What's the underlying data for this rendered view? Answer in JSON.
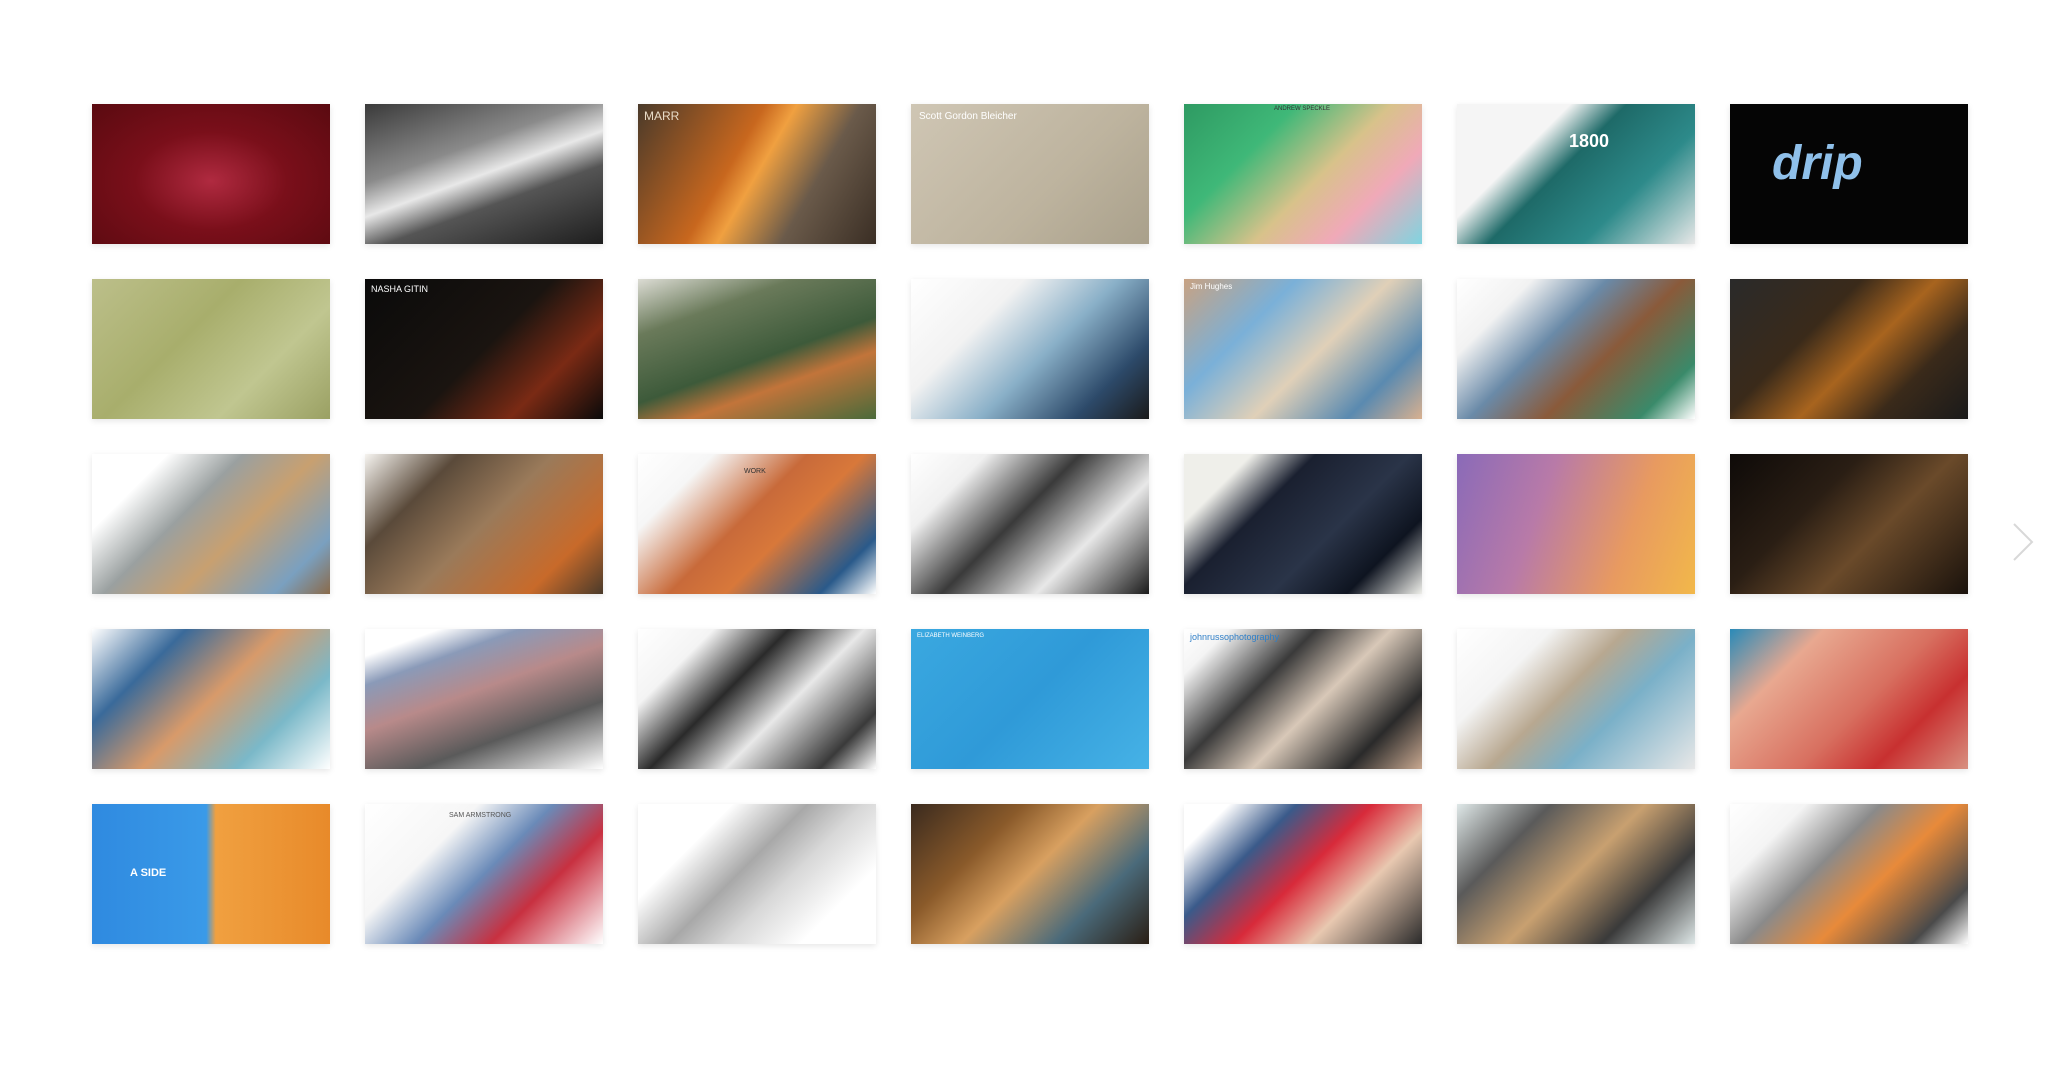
{
  "gallery": {
    "tiles": [
      {
        "name": "portrait-red-fashion",
        "bg": "radial-gradient(ellipse at 50% 55%, #b02a40 0%, #7a0f1a 45%, #5a0a10 100%)"
      },
      {
        "name": "mountain-bw",
        "bg": "linear-gradient(160deg, #3a3a3a 0%, #8a8a8a 35%, #e8e8e8 50%, #555 65%, #1e1e1e 100%)"
      },
      {
        "name": "welding-sparks",
        "bg": "linear-gradient(120deg, #4a3a2a 0%, #c8671e 40%, #f0a040 50%, #6a5a4a 70%, #3a2e24 100%)",
        "label": "MARR",
        "labelColor": "#e8dcc8",
        "labelSize": "12px",
        "labelTop": "6px",
        "labelLeft": "6px"
      },
      {
        "name": "scott-gordon-bleicher",
        "bg": "linear-gradient(135deg, #cfc6b4 0%, #bdb39e 60%, #a9a08b 100%)",
        "label": "Scott Gordon Bleicher",
        "labelColor": "#ffffff",
        "labelSize": "10px",
        "labelTop": "8px",
        "labelLeft": "8px"
      },
      {
        "name": "andrew-collage",
        "bg": "linear-gradient(135deg, #2e9a62 0%, #3fb878 30%, #d8c28a 55%, #f0a9b8 75%, #7fd4e0 100%)",
        "label": "ANDREW SPECKLE",
        "labelColor": "#333333",
        "labelSize": "6px",
        "labelTop": "2px",
        "labelLeft": "90px"
      },
      {
        "name": "tequila-1800",
        "bg": "linear-gradient(135deg, #f5f5f5 0%, #f5f5f5 30%, #1e6a68 45%, #2d8a8a 70%, #e8e8e8 100%)",
        "label": "1800",
        "labelColor": "#ffffff",
        "labelSize": "18px",
        "labelTop": "28px",
        "labelLeft": "112px"
      },
      {
        "name": "drip-logo",
        "bg": "#050505",
        "label": "drip",
        "labelColor": "#8fc0ea",
        "labelSize": "48px",
        "labelTop": "36px",
        "labelLeft": "42px"
      },
      {
        "name": "green-fruit",
        "bg": "linear-gradient(135deg, #bcbf8a 0%, #a8ae6c 40%, #c0c690 70%, #9aa063 100%)"
      },
      {
        "name": "nasha-gitin-whisky",
        "bg": "linear-gradient(135deg, #0a0a0a 0%, #1a1410 50%, #7a2a14 75%, #0a0a0a 100%)",
        "label": "NASHA GITIN",
        "labelColor": "#ffffff",
        "labelSize": "9px",
        "labelTop": "6px",
        "labelLeft": "6px"
      },
      {
        "name": "red-hair-lake",
        "bg": "linear-gradient(160deg, #dcdcd4 0%, #6a7a5a 25%, #3d5a3a 55%, #c2743a 70%, #4a6a3a 100%)"
      },
      {
        "name": "sports-portraits",
        "bg": "linear-gradient(135deg, #ffffff 0%, #f2f2f2 30%, #8ab0c8 55%, #2d4a6a 80%, #1a1a1a 100%)"
      },
      {
        "name": "travel-collage",
        "bg": "linear-gradient(135deg, #c8a282 0%, #7ab0d8 30%, #e0d0b8 55%, #5a8ab0 80%, #d8b090 100%)",
        "label": "Jim Hughes",
        "labelColor": "#ffffff",
        "labelSize": "8px",
        "labelTop": "4px",
        "labelLeft": "6px"
      },
      {
        "name": "nick-portfolio",
        "bg": "linear-gradient(135deg, #ffffff 0%, #f2f2f2 20%, #6a8aa8 40%, #8a5a3a 60%, #3a8a6a 85%, #ffffff 100%)"
      },
      {
        "name": "burger-food",
        "bg": "linear-gradient(135deg, #2a2a2a 0%, #3a2a1a 35%, #a8641e 55%, #3a2a1a 75%, #1a1a1a 100%)"
      },
      {
        "name": "machine-collage",
        "bg": "linear-gradient(135deg, #ffffff 0%, #ffffff 20%, #9aa0a0 40%, #c8a070 60%, #7aa0c0 85%, #8a6a4a 100%)"
      },
      {
        "name": "johnson-collage",
        "bg": "linear-gradient(135deg, #f6f4f0 0%, #5a4a3a 25%, #9a7a5a 50%, #c86a2a 80%, #4a3a2a 100%)"
      },
      {
        "name": "work-collage",
        "bg": "linear-gradient(135deg, #ffffff 0%, #f6f6f6 20%, #c86a3a 45%, #d8783a 60%, #2a5a8a 85%, #ffffff 100%)",
        "label": "WORK",
        "labelColor": "#333333",
        "labelSize": "7px",
        "labelTop": "14px",
        "labelLeft": "106px"
      },
      {
        "name": "nick-werner-bw",
        "bg": "linear-gradient(135deg, #ffffff 0%, #f0f0f0 20%, #3a3a3a 45%, #e8e8e8 70%, #1a1a1a 100%)"
      },
      {
        "name": "boxer-dark",
        "bg": "linear-gradient(135deg, #efefea 0%, #efefea 18%, #1a2030 35%, #2a3448 60%, #0e1420 80%, #efefea 100%)"
      },
      {
        "name": "kickboxer-gradient",
        "bg": "linear-gradient(110deg, #8a6ab8 0%, #b87aa8 35%, #e89a60 70%, #f2b84a 100%)"
      },
      {
        "name": "dark-corridor",
        "bg": "linear-gradient(135deg, #0e0a08 0%, #2a1e14 35%, #6a4a2a 60%, #1a120c 100%)"
      },
      {
        "name": "beach-collage",
        "bg": "linear-gradient(135deg, #ffffff 0%, #3a6a9a 25%, #d89a6a 50%, #7ab8c8 75%, #ffffff 100%)"
      },
      {
        "name": "car-landscape",
        "bg": "linear-gradient(160deg, #ffffff 0%, #ffffff 12%, #8a9ab8 25%, #b88a8a 45%, #5a5a5a 70%, #ffffff 100%)"
      },
      {
        "name": "bw-portraits",
        "bg": "linear-gradient(135deg, #ffffff 0%, #f4f4f4 20%, #2a2a2a 40%, #e8e8e8 60%, #3a3a3a 85%, #ffffff 100%)"
      },
      {
        "name": "blue-collage",
        "bg": "linear-gradient(135deg, #3aa8e0 0%, #2f9ad8 50%, #46b2e6 100%)",
        "label": "ELIZABETH WEINBERG",
        "labelColor": "#ffffff",
        "labelSize": "6px",
        "labelTop": "4px",
        "labelLeft": "6px"
      },
      {
        "name": "johnrusso-magazines",
        "bg": "linear-gradient(135deg, #ffffff 0%, #f4f4f4 12%, #3a3a3a 35%, #d8c8b8 55%, #2a2a2a 80%, #c8a890 100%)",
        "label": "johnrussophotography",
        "labelColor": "#2f7fc8",
        "labelSize": "9px",
        "labelTop": "4px",
        "labelLeft": "6px"
      },
      {
        "name": "interior-collage",
        "bg": "linear-gradient(135deg, #ffffff 0%, #f4f4f4 25%, #b8a890 45%, #7ab0c8 65%, #e8e8e8 100%)"
      },
      {
        "name": "strawberry-lips",
        "bg": "linear-gradient(135deg, #2a8ab8 0%, #e8a890 25%, #d87060 55%, #c83030 75%, #d89080 100%)"
      },
      {
        "name": "a-side-portrait",
        "bg": "linear-gradient(90deg, #2f8ae0 0%, #3a9ae8 48%, #f0a040 52%, #e88a2a 100%)",
        "label": "A SIDE",
        "labelColor": "#ffffff",
        "labelSize": "11px",
        "labelTop": "64px",
        "labelLeft": "38px"
      },
      {
        "name": "sam-armstrong",
        "bg": "linear-gradient(135deg, #ffffff 0%, #f6f6f6 30%, #6a8ab8 50%, #c83040 70%, #ffffff 100%)",
        "label": "SAM ARMSTRONG",
        "labelColor": "#555555",
        "labelSize": "7px",
        "labelTop": "8px",
        "labelLeft": "84px"
      },
      {
        "name": "abstract-white",
        "bg": "linear-gradient(135deg, #ffffff 0%, #ffffff 25%, #a8a8a8 45%, #d8d8d8 60%, #ffffff 80%)"
      },
      {
        "name": "kids-tablet",
        "bg": "linear-gradient(135deg, #3a2a1e 0%, #8a5a2a 30%, #d8a060 50%, #4a6a7a 75%, #2a1e14 100%)"
      },
      {
        "name": "frankie-batista",
        "bg": "linear-gradient(135deg, #ffffff 0%, #ffffff 12%, #3a5a8a 30%, #d82a3a 50%, #e8c8b0 70%, #2a2a2a 100%)"
      },
      {
        "name": "desert-grid",
        "bg": "linear-gradient(135deg, #dfe8e8 0%, #5a5a5a 25%, #c8a070 50%, #3a3a3a 75%, #dfe8e8 100%)"
      },
      {
        "name": "dominic-athletes",
        "bg": "linear-gradient(135deg, #ffffff 0%, #f4f4f4 20%, #8a8a8a 40%, #e88a3a 60%, #4a4a4a 85%, #ffffff 100%)"
      }
    ]
  },
  "controls": {
    "next_icon": "chevron-right-icon"
  }
}
